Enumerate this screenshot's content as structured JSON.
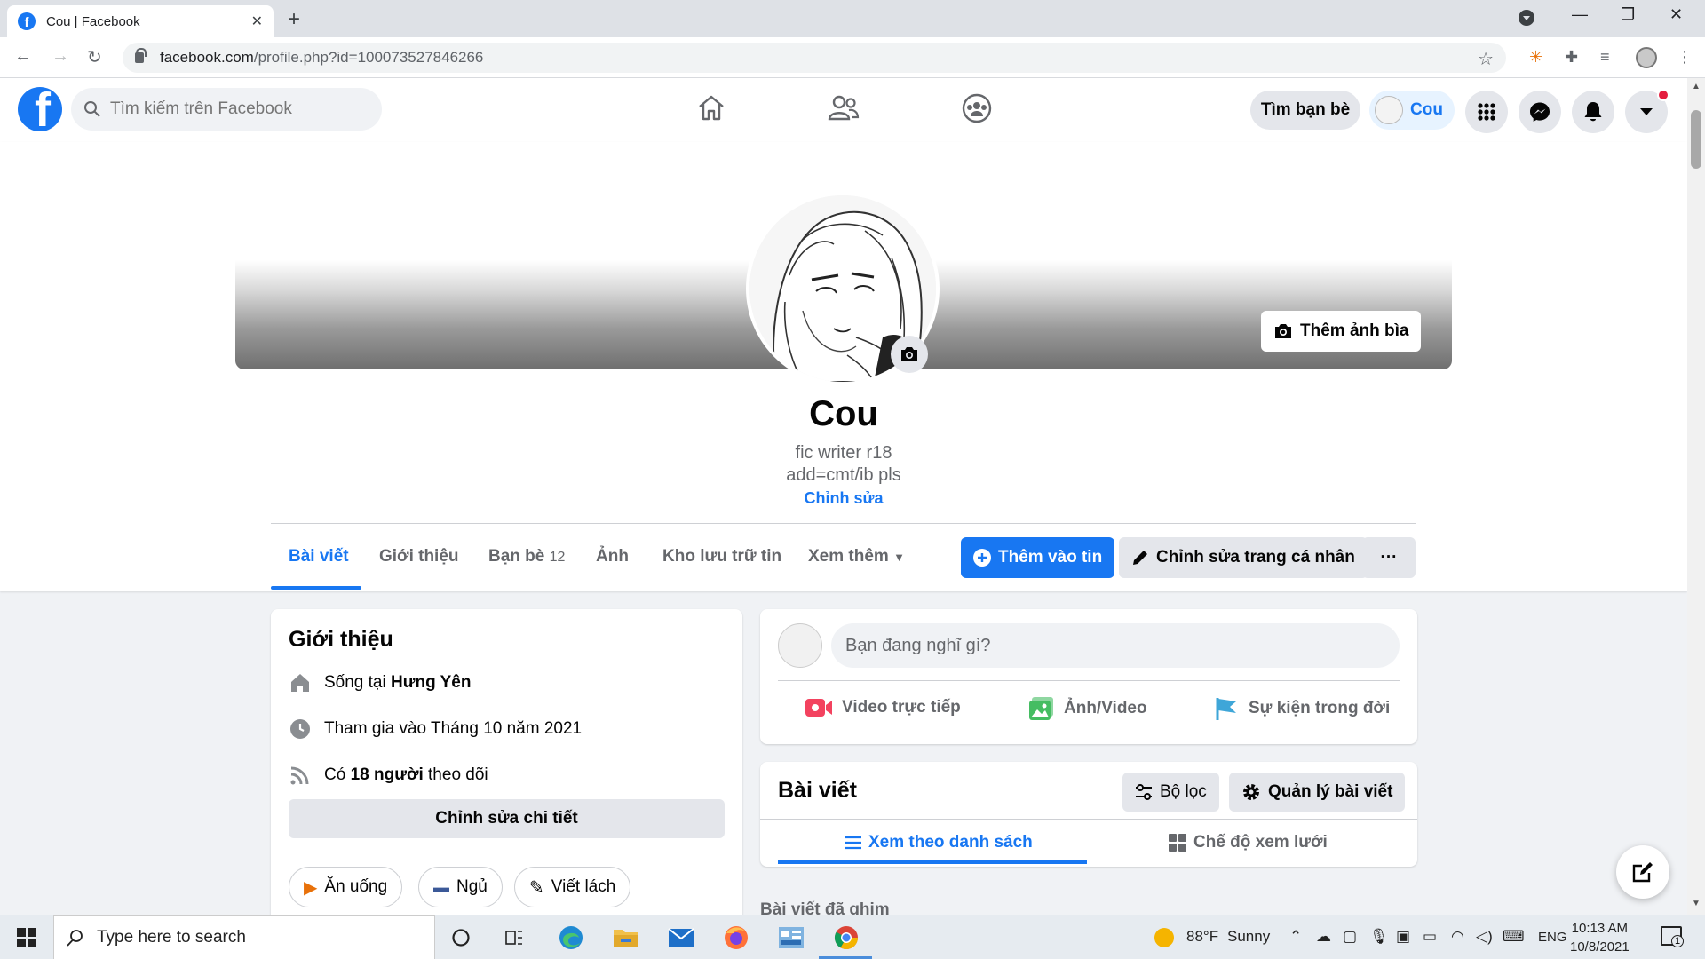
{
  "browser": {
    "tab_title": "Cou | Facebook",
    "tab_favicon": "f",
    "new_tab": "+",
    "url_host": "facebook.com",
    "url_path": "/profile.php?id=100073527846266"
  },
  "fb_nav": {
    "logo": "f",
    "search_placeholder": "Tìm kiếm trên Facebook",
    "find_friends": "Tìm bạn bè",
    "profile_name": "Cou",
    "icons": [
      "home-icon",
      "friends-icon",
      "groups-icon",
      "menu-grid-icon",
      "messenger-icon",
      "notifications-icon",
      "account-caret-icon"
    ]
  },
  "profile": {
    "cover_button": "Thêm ảnh bìa",
    "name": "Cou",
    "bio_line1": "fic writer r18",
    "bio_line2": "add=cmt/ib pls",
    "edit_bio": "Chỉnh sửa",
    "tabs": [
      {
        "label": "Bài viết"
      },
      {
        "label": "Giới thiệu"
      },
      {
        "label": "Bạn bè",
        "count": "12"
      },
      {
        "label": "Ảnh"
      },
      {
        "label": "Kho lưu trữ tin"
      },
      {
        "label": "Xem thêm"
      }
    ],
    "add_story": "Thêm vào tin",
    "edit_profile": "Chỉnh sửa trang cá nhân",
    "more": "···"
  },
  "intro": {
    "title": "Giới thiệu",
    "lives_prefix": "Sống tại ",
    "lives_place": "Hưng Yên",
    "joined": "Tham gia vào Tháng 10 năm 2021",
    "followers_prefix": "Có ",
    "followers_count": "18 người",
    "followers_suffix": " theo dõi",
    "edit_details": "Chỉnh sửa chi tiết",
    "hobbies": [
      "Ăn uống",
      "Ngủ",
      "Viết lách"
    ]
  },
  "composer": {
    "placeholder": "Bạn đang nghĩ gì?",
    "live": "Video trực tiếp",
    "photo": "Ảnh/Video",
    "life_event": "Sự kiện trong đời"
  },
  "posts": {
    "title": "Bài viết",
    "filter": "Bộ lọc",
    "manage": "Quản lý bài viết",
    "list_view": "Xem theo danh sách",
    "grid_view": "Chế độ xem lưới",
    "pinned": "Bài viết đã ghim"
  },
  "taskbar": {
    "search_placeholder": "Type here to search",
    "weather_temp": "88°F",
    "weather_desc": "Sunny",
    "language": "ENG",
    "time": "10:13 AM",
    "date": "10/8/2021",
    "notif_count": "1"
  },
  "colors": {
    "fb_blue": "#1877f2",
    "live_red": "#f3425f",
    "photo_green": "#45bd62",
    "event_blue": "#3ea6d8",
    "notif_red": "#e41e3f"
  }
}
